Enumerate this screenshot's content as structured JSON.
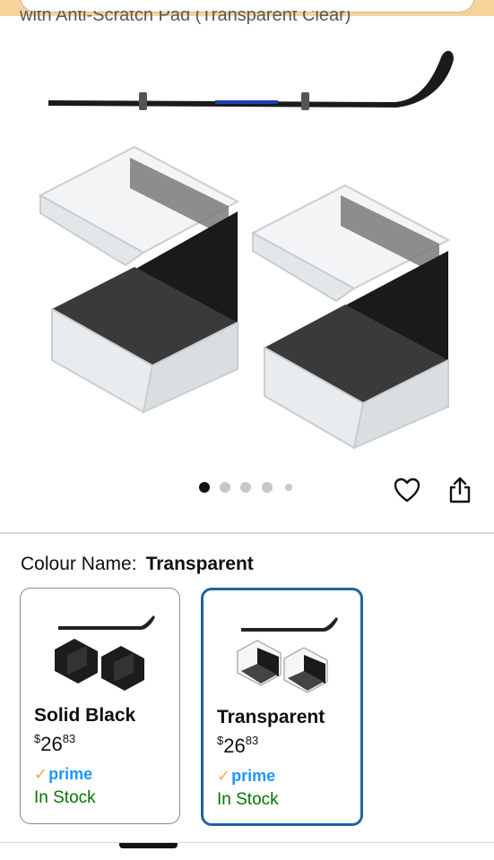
{
  "product": {
    "title_fragment": "with Anti-Scratch Pad (Transparent Clear)"
  },
  "carousel": {
    "dot_count": 5,
    "active_index": 0
  },
  "actions": {
    "wishlist_icon": "heart-icon",
    "share_icon": "share-icon"
  },
  "variation": {
    "label": "Colour Name:",
    "selected": "Transparent"
  },
  "swatches": [
    {
      "name": "Solid Black",
      "price_currency": "$",
      "price_whole": "26",
      "price_fraction": "83",
      "prime_check": "✓",
      "prime_text": "prime",
      "stock": "In Stock",
      "selected": false
    },
    {
      "name": "Transparent",
      "price_currency": "$",
      "price_whole": "26",
      "price_fraction": "83",
      "prime_check": "✓",
      "prime_text": "prime",
      "stock": "In Stock",
      "selected": true
    }
  ],
  "colors": {
    "banner": "#f6d49b",
    "selected_border": "#2162a1",
    "in_stock": "#007600",
    "prime_blue": "#1a98ff",
    "prime_check": "#f3a847"
  }
}
